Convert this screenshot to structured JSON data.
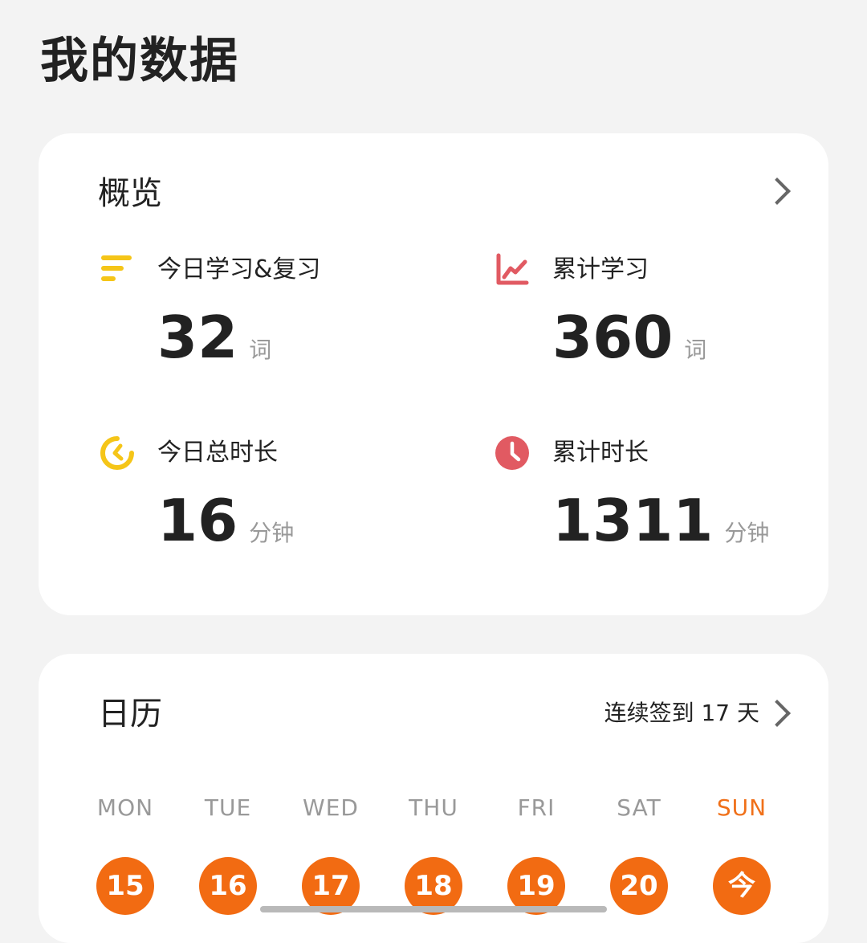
{
  "page": {
    "title": "我的数据"
  },
  "overview": {
    "title": "概览",
    "stats": [
      {
        "label": "今日学习&复习",
        "value": "32",
        "unit": "词",
        "icon": "bars-icon",
        "color": "#f5c518"
      },
      {
        "label": "累计学习",
        "value": "360",
        "unit": "词",
        "icon": "line-chart-icon",
        "color": "#e15a62"
      },
      {
        "label": "今日总时长",
        "value": "16",
        "unit": "分钟",
        "icon": "timer-icon",
        "color": "#f5c518"
      },
      {
        "label": "累计时长",
        "value": "1311",
        "unit": "分钟",
        "icon": "clock-icon",
        "color": "#e15a62"
      }
    ]
  },
  "calendar": {
    "title": "日历",
    "streak_text": "连续签到 17 天",
    "weekdays": [
      "MON",
      "TUE",
      "WED",
      "THU",
      "FRI",
      "SAT",
      "SUN"
    ],
    "dates": [
      "15",
      "16",
      "17",
      "18",
      "19",
      "20",
      "今"
    ],
    "accent_color": "#f26b12"
  }
}
